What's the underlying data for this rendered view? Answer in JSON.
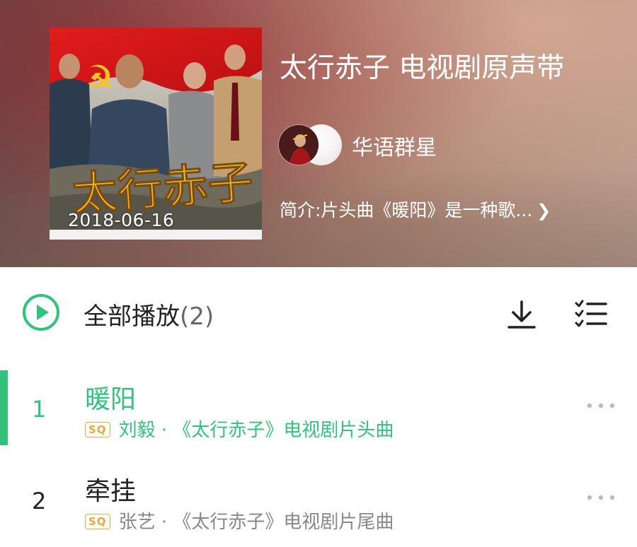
{
  "album": {
    "title": "太行赤子 电视剧原声带",
    "release_date": "2018-06-16",
    "artist": "华语群星",
    "intro": "简介:片头曲《暖阳》是一种歌...",
    "cover_calligraphy": "太行赤子"
  },
  "toolbar": {
    "play_all_label": "全部播放",
    "play_all_count": "(2)"
  },
  "tracks": [
    {
      "index": "1",
      "title": "暖阳",
      "quality": "SQ",
      "meta": "刘毅 · 《太行赤子》电视剧片头曲",
      "active": true
    },
    {
      "index": "2",
      "title": "牵挂",
      "quality": "SQ",
      "meta": "张艺 · 《太行赤子》电视剧片尾曲",
      "active": false
    }
  ],
  "colors": {
    "accent": "#31c27c",
    "sq_badge": "#e8a83c",
    "text_primary": "#222222",
    "text_secondary": "#888888"
  },
  "icons": {
    "play_all": "play-circle-icon",
    "download": "download-icon",
    "multiselect": "list-checklist-icon",
    "more": "more-dots-icon",
    "chevron": "chevron-right-icon"
  }
}
